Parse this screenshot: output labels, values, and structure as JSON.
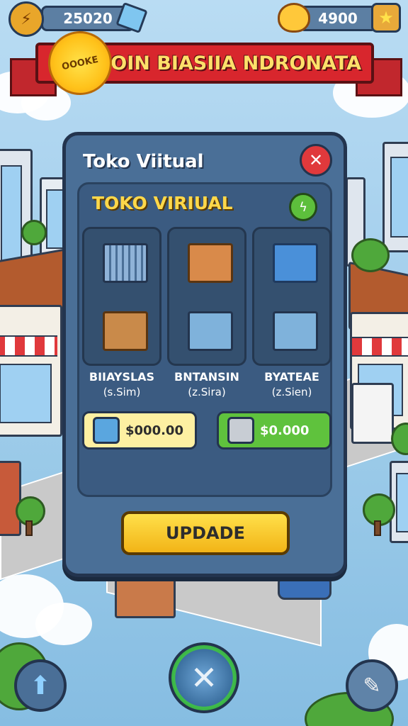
{
  "hud": {
    "coins": "25020",
    "duck_points": "4900"
  },
  "banner": {
    "badge": "OOOKE",
    "title": "JOIN BIASIIA NDRONATA"
  },
  "shop": {
    "window_title": "Toko Viitual",
    "header": "TOKO VIRIUAL",
    "items": [
      {
        "name": "BIIAYSLAS",
        "sub": "(s.Sim)"
      },
      {
        "name": "BNTANSIN",
        "sub": "(z.Sira)"
      },
      {
        "name": "BYATEAE",
        "sub": "(z.Sien)"
      }
    ],
    "price_a": "$000.00",
    "price_b": "$0.000",
    "update_label": "UPDADE"
  },
  "colors": {
    "accent_yellow": "#ffd84a",
    "banner_red": "#d8262d",
    "modal_blue": "#4a6f97",
    "close_red": "#e0393c",
    "green": "#5fc23d"
  },
  "icons": {
    "coins": "lightning-coin-icon",
    "gem": "gem-icon",
    "duck": "duck-icon",
    "star": "star-icon",
    "close": "close-icon",
    "bolt": "bolt-icon",
    "up": "arrow-up-icon",
    "tools": "tools-icon",
    "avatar": "pen-avatar-icon"
  }
}
